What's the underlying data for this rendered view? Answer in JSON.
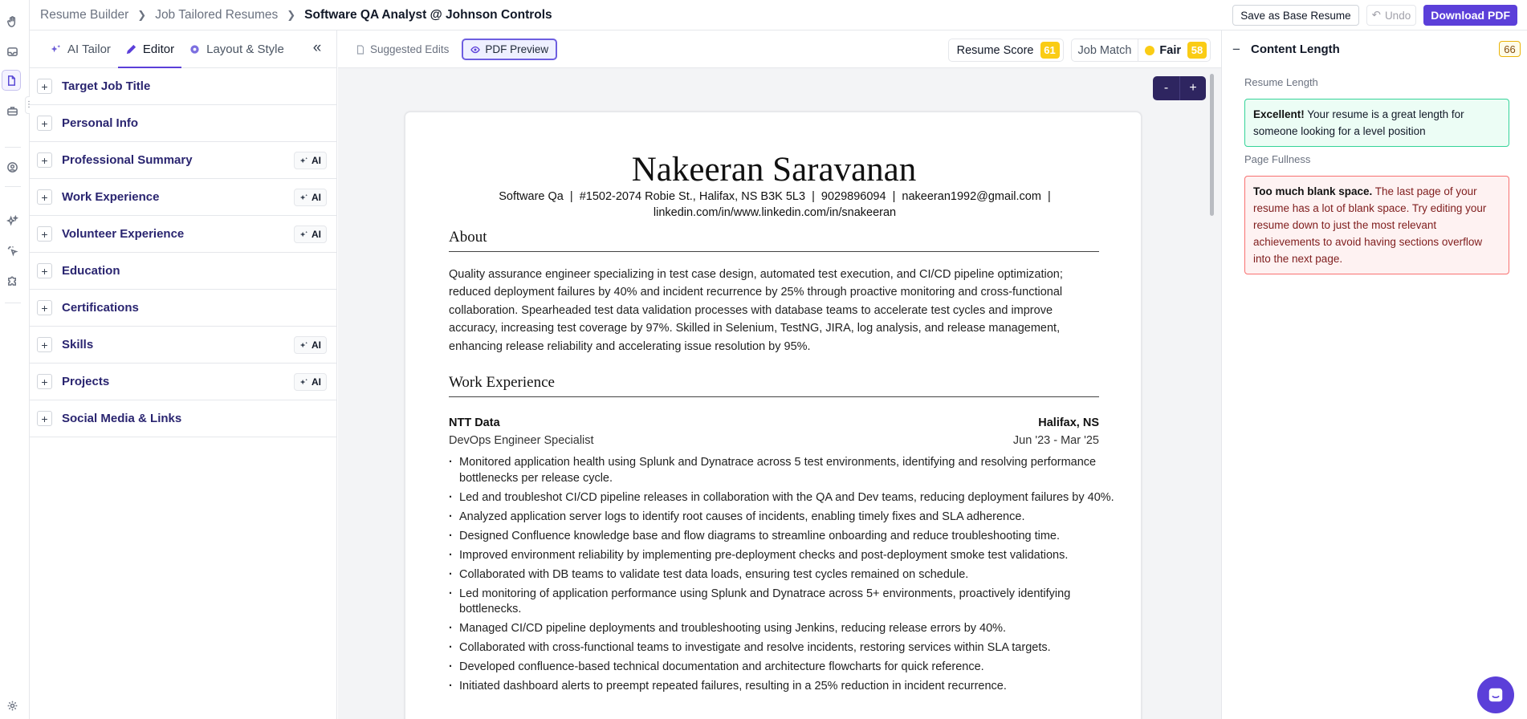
{
  "breadcrumb": {
    "items": [
      "Resume Builder",
      "Job Tailored Resumes"
    ],
    "current": "Software QA Analyst @ Johnson Controls"
  },
  "header_actions": {
    "save_base": "Save as Base Resume",
    "undo": "Undo",
    "download": "Download PDF"
  },
  "editor_tabs": [
    "AI Tailor",
    "Editor",
    "Layout & Style"
  ],
  "sections": [
    {
      "label": "Target Job Title",
      "ai": false
    },
    {
      "label": "Personal Info",
      "ai": false
    },
    {
      "label": "Professional Summary",
      "ai": true
    },
    {
      "label": "Work Experience",
      "ai": true
    },
    {
      "label": "Volunteer Experience",
      "ai": true
    },
    {
      "label": "Education",
      "ai": false
    },
    {
      "label": "Certifications",
      "ai": false
    },
    {
      "label": "Skills",
      "ai": true
    },
    {
      "label": "Projects",
      "ai": true
    },
    {
      "label": "Social Media & Links",
      "ai": false
    }
  ],
  "ai_badge": "AI",
  "center_tabs": {
    "suggested": "Suggested Edits",
    "preview": "PDF Preview"
  },
  "scores": {
    "resume_score_label": "Resume Score",
    "resume_score_value": "61",
    "job_match_label": "Job Match",
    "job_match_rating": "Fair",
    "job_match_value": "58"
  },
  "zoom": {
    "minus": "-",
    "plus": "+"
  },
  "resume": {
    "name": "Nakeeran Saravanan",
    "contact_line1": "Software Qa  |  #1502-2074 Robie St., Halifax, NS B3K 5L3  |  9029896094  |  nakeeran1992@gmail.com  |",
    "contact_line2": "linkedin.com/in/www.linkedin.com/in/snakeeran",
    "about_heading": "About",
    "about_text": "Quality assurance engineer specializing in test case design, automated test execution, and CI/CD pipeline optimization; reduced deployment failures by 40% and incident recurrence by 25% through proactive monitoring and cross-functional collaboration. Spearheaded test data validation processes with database teams to accelerate test cycles and improve accuracy, increasing test coverage by 97%. Skilled in Selenium, TestNG, JIRA, log analysis, and release management, enhancing release reliability and accelerating issue resolution by 95%.",
    "work_heading": "Work Experience",
    "job": {
      "company": "NTT Data",
      "location": "Halifax, NS",
      "title": "DevOps Engineer Specialist",
      "dates": "Jun '23 - Mar '25",
      "bullets": [
        "Monitored application health using Splunk and Dynatrace across 5 test environments, identifying and resolving  performance bottlenecks per release cycle.",
        "Led and troubleshot CI/CD pipeline releases in collaboration with the QA and Dev teams, reducing deployment failures by 40%.",
        "Analyzed application server logs to identify root causes of incidents, enabling timely fixes and SLA adherence.",
        "Designed Confluence knowledge base and flow diagrams to streamline onboarding and reduce troubleshooting time.",
        "Improved environment reliability by implementing pre-deployment checks and post-deployment smoke test validations.",
        "Collaborated with DB teams to validate test data loads, ensuring test cycles remained on schedule.",
        "Led monitoring of application performance using Splunk and Dynatrace across 5+ environments, proactively identifying bottlenecks.",
        "Managed CI/CD pipeline deployments and troubleshooting using Jenkins, reducing release errors by 40%.",
        "Collaborated with cross-functional teams to investigate and resolve incidents, restoring services within SLA targets.",
        "Developed confluence-based technical documentation and architecture flowcharts for quick reference.",
        "Initiated dashboard alerts to preempt repeated failures, resulting in a 25% reduction in incident recurrence."
      ]
    }
  },
  "content_length": {
    "title": "Content Length",
    "score": "66",
    "resume_length_label": "Resume Length",
    "resume_length_bold": "Excellent!",
    "resume_length_text": " Your resume is a great length for someone looking for a level position",
    "page_fullness_label": "Page Fullness",
    "page_fullness_bold": "Too much blank space.",
    "page_fullness_text": " The last page of your resume has a lot of blank space. Try editing your resume down to just the most relevant achievements to avoid having sections overflow into the next page."
  },
  "colors": {
    "accent": "#5b3fd9",
    "score_yellow": "#facc15"
  }
}
